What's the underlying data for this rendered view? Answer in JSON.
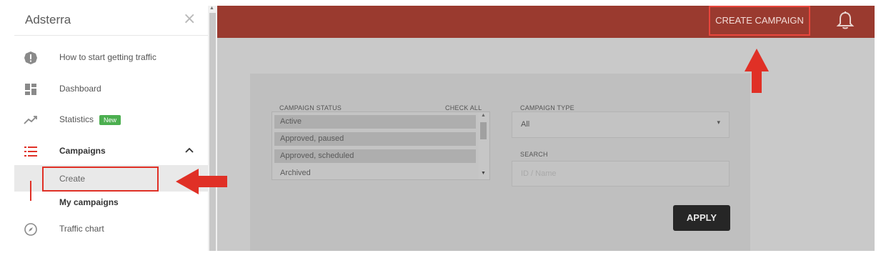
{
  "sidebar": {
    "title": "Adsterra",
    "close_icon": "close-icon",
    "items": [
      {
        "label": "How to start getting traffic",
        "icon": "alert-icon"
      },
      {
        "label": "Dashboard",
        "icon": "dashboard-icon"
      },
      {
        "label": "Statistics",
        "icon": "trending-icon",
        "badge": "New"
      },
      {
        "label": "Campaigns",
        "icon": "list-icon"
      },
      {
        "label": "Traffic chart",
        "icon": "compass-icon"
      }
    ],
    "submenu": {
      "create": "Create",
      "my_campaigns": "My campaigns"
    }
  },
  "topbar": {
    "create_button": "CREATE CAMPAIGN",
    "bell_icon": "bell-icon"
  },
  "filters": {
    "status_label": "CAMPAIGN STATUS",
    "check_all": "CHECK ALL",
    "status_options": [
      "Active",
      "Approved, paused",
      "Approved, scheduled",
      "Archived"
    ],
    "type_label": "CAMPAIGN TYPE",
    "type_value": "All",
    "search_label": "SEARCH",
    "search_placeholder": "ID / Name",
    "apply": "APPLY"
  },
  "colors": {
    "topbar": "#9a3a2f",
    "highlight": "#e03026",
    "badge": "#4caf50"
  }
}
